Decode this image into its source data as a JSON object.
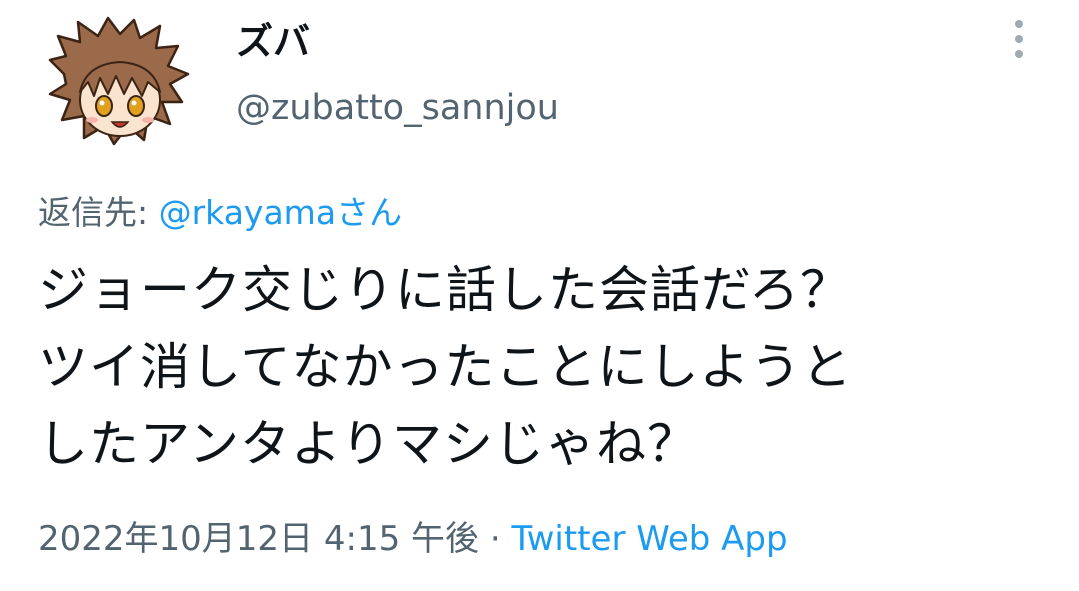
{
  "tweet": {
    "user": {
      "display_name": "ズバ",
      "handle": "@zubatto_sannjou",
      "avatar_icon": "chibi-character-avatar"
    },
    "reply_to": {
      "prefix": "返信先: ",
      "mention": "@rkayama",
      "suffix": "さん"
    },
    "text_lines": [
      "ジョーク交じりに話した会話だろ？",
      "ツイ消してなかったことにしようと",
      "したアンタよりマシじゃね？"
    ],
    "timestamp": "2022年10月12日 4:15 午後",
    "separator": " · ",
    "source": "Twitter Web App",
    "more_icon": "vertical-ellipsis-icon"
  },
  "colors": {
    "text": "#0f1419",
    "secondary": "#536471",
    "accent": "#1d9bf0",
    "background": "#ffffff"
  }
}
